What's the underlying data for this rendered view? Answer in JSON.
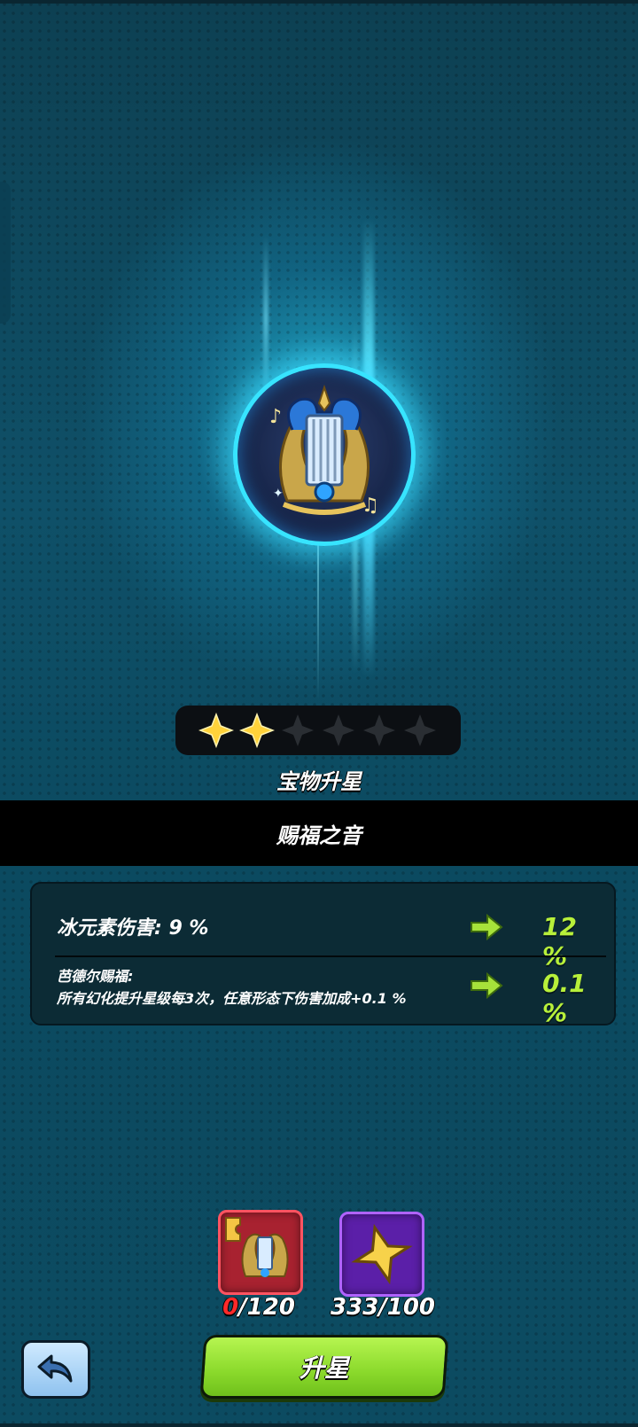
{
  "treasure": {
    "icon": "lyre-emblem-icon",
    "section_label": "宝物升星",
    "name": "赐福之音",
    "stars": {
      "filled": 2,
      "total": 6,
      "filled_color": "#ffd23a",
      "empty_color": "#2a2e33"
    }
  },
  "stats": [
    {
      "label": "冰元素伤害: 9 %",
      "value": "12 %"
    },
    {
      "label_line1": "芭德尔赐福:",
      "label_line2": "所有幻化提升星级每3次，任意形态下伤害加成+0.1 %",
      "value": "0.1 %"
    }
  ],
  "cost": [
    {
      "icon": "lyre-fragment-icon",
      "have": "0",
      "need": "/120"
    },
    {
      "icon": "gold-star-icon",
      "text": "333/100"
    }
  ],
  "buttons": {
    "back_icon": "back-arrow-icon",
    "upgrade_label": "升星"
  },
  "colors": {
    "accent_green": "#b8f03a",
    "glow_cyan": "#37e4ff"
  }
}
